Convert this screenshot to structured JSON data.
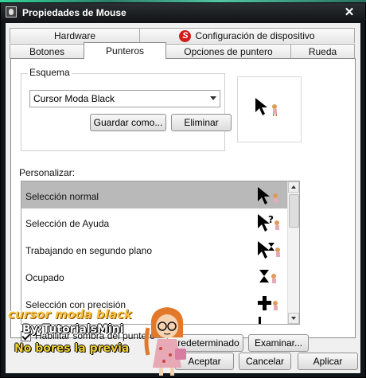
{
  "window": {
    "title": "Propiedades de Mouse",
    "close_symbol": "✕"
  },
  "tabs_top": [
    {
      "label": "Hardware"
    },
    {
      "label": "Configuración de dispositivo",
      "icon": "synaptics-icon"
    }
  ],
  "tabs_bottom": [
    {
      "label": "Botones"
    },
    {
      "label": "Punteros",
      "active": true
    },
    {
      "label": "Opciones de puntero"
    },
    {
      "label": "Rueda"
    }
  ],
  "scheme": {
    "legend": "Esquema",
    "selected": "Cursor Moda Black",
    "save_as_label": "Guardar como...",
    "delete_label": "Eliminar"
  },
  "customize": {
    "label": "Personalizar:",
    "items": [
      {
        "label": "Selección normal",
        "selected": true,
        "icon": "arrow-girl-cursor"
      },
      {
        "label": "Selección de Ayuda",
        "icon": "help-girl-cursor"
      },
      {
        "label": "Trabajando en segundo plano",
        "icon": "busy-arrow-girl-cursor"
      },
      {
        "label": "Ocupado",
        "icon": "hourglass-girl-cursor"
      },
      {
        "label": "Selección con precisión",
        "icon": "crosshair-girl-cursor"
      }
    ]
  },
  "shadow": {
    "label": "Habilitar sombra del puntero",
    "checked": true
  },
  "buttons": {
    "default_label": "Predeterminado",
    "browse_label": "Examinar...",
    "accept_label": "Aceptar",
    "cancel_label": "Cancelar",
    "apply_label": "Aplicar"
  },
  "watermark": {
    "line1": "cursor moda black",
    "line2": "By:TutorialsMini",
    "line3": "No bores la previa"
  },
  "colors": {
    "titlebar": "#121416",
    "selection": "#b9b9b9",
    "synaptics_red": "#d21c1c"
  }
}
